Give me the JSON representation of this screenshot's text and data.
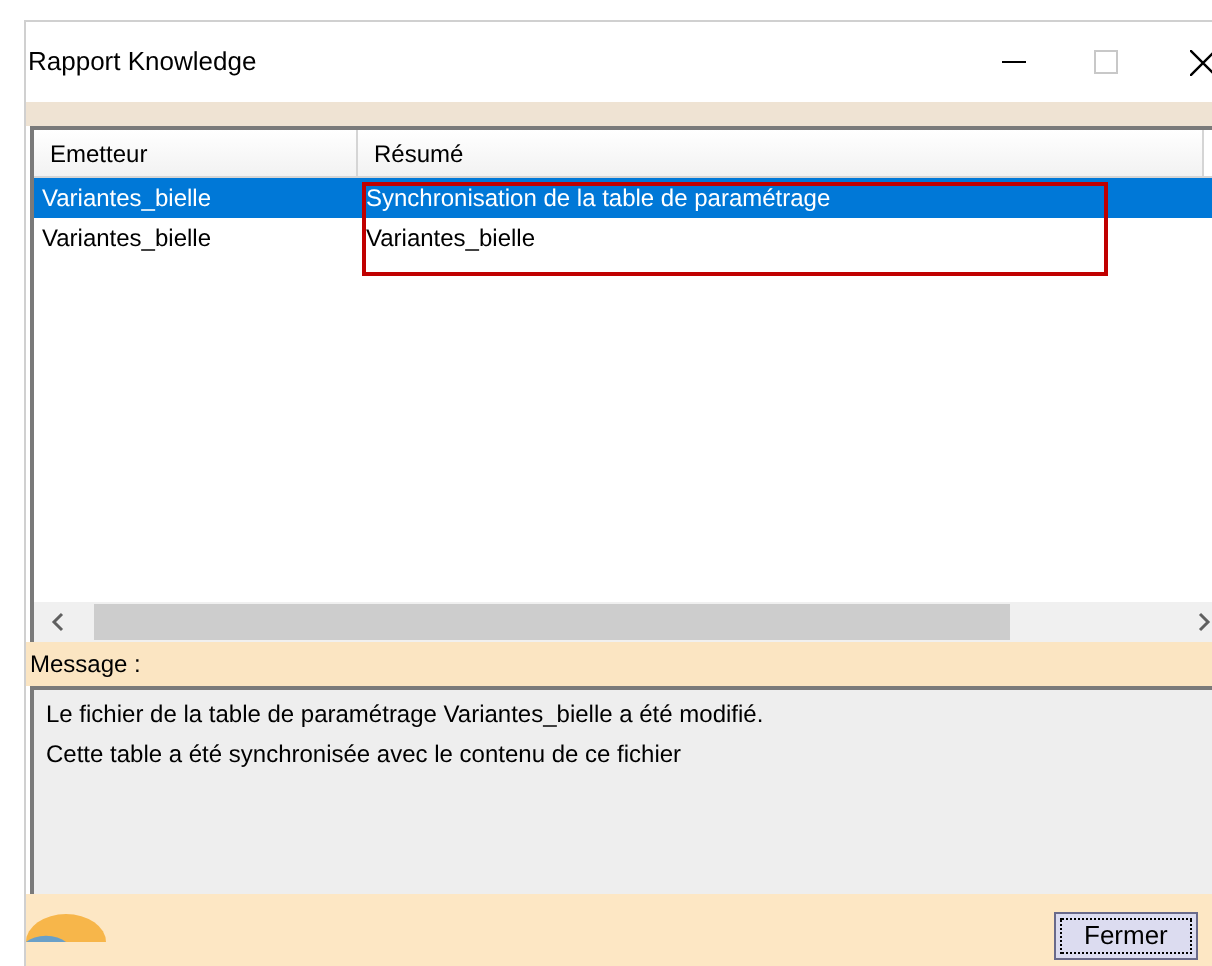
{
  "window": {
    "title": "Rapport Knowledge"
  },
  "table": {
    "columns": [
      "Emetteur",
      "Résumé"
    ],
    "rows": [
      {
        "cells": [
          "Variantes_bielle",
          "Synchronisation de la table de paramétrage"
        ],
        "selected": true
      },
      {
        "cells": [
          "Variantes_bielle",
          "Variantes_bielle"
        ],
        "selected": false
      }
    ]
  },
  "message": {
    "label": "Message :",
    "lines": [
      "Le fichier de la table de paramétrage Variantes_bielle a été modifié.",
      "Cette table a été synchronisée avec le contenu de ce fichier"
    ]
  },
  "buttons": [
    "Fermer"
  ]
}
